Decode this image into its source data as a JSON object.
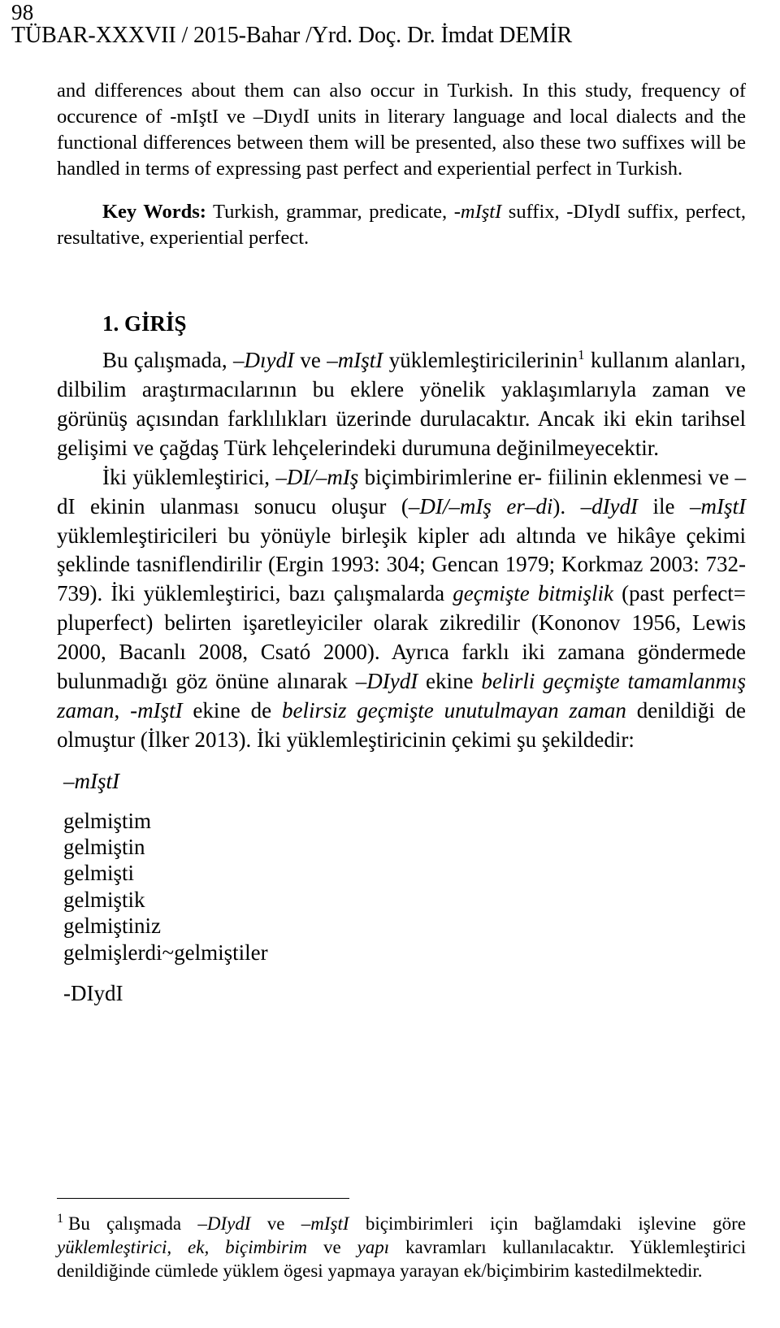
{
  "header": {
    "page_number": "98",
    "running_head": "TÜBAR-XXXVII / 2015-Bahar /Yrd. Doç. Dr. İmdat DEMİR"
  },
  "abstract": {
    "continuation": "and differences about them can also occur in Turkish. In this study, frequency of occurence of -mIştI ve –DıydI units in literary language and local dialects and the functional differences between them will be presented, also these two suffixes will be handled in terms of expressing past perfect and experiential perfect in Turkish.",
    "keywords_label": "Key Words:",
    "keywords_text": "Turkish, grammar, predicate, -mIştI suffix, -DIydI suffix, perfect, resultative, experiential perfect."
  },
  "section": {
    "number_title": "1. GİRİŞ",
    "paragraphs": [
      "Bu çalışmada, –DıydI ve –mIştI yüklemleştiricilerinin1 kullanım alanları, dilbilim araştırmacılarının bu eklere yönelik yaklaşımlarıyla zaman ve görünüş açısından farklılıkları üzerinde durulacaktır. Ancak iki ekin tarihsel gelişimi ve çağdaş Türk lehçelerindeki durumuna değinilmeyecektir.",
      "İki yüklemleştirici, –DI/–mIş biçimbirimlerine er- fiilinin eklenmesi ve –dI ekinin ulanması sonucu oluşur (–DI/–mIş er–di). –dIydI ile –mIştI yüklemleştiricileri bu yönüyle birleşik kipler adı altında ve hikâye çekimi şeklinde tasniflendirilir (Ergin 1993: 304; Gencan 1979; Korkmaz 2003: 732-739). İki yüklemleştirici, bazı çalışmalarda geçmişte bitmişlik (past perfect= pluperfect) belirten işaretleyiciler olarak zikredilir (Kononov 1956, Lewis 2000, Bacanlı 2008, Csató 2000). Ayrıca farklı iki zamana göndermede bulunmadığı göz önüne alınarak –DIydI ekine belirli geçmişte tamamlanmış zaman, -mIştI ekine de belirsiz geçmişte unutulmayan zaman denildiği de olmuştur (İlker 2013). İki yüklemleştiricinin çekimi şu şekildedir:"
    ]
  },
  "paradigm": {
    "heading": "–mIştI",
    "forms": [
      "gelmiştim",
      "gelmiştin",
      "gelmişti",
      "gelmiştik",
      "gelmiştiniz",
      "gelmişlerdi~gelmiştiler"
    ],
    "second_heading": "-DIydI"
  },
  "footnote": {
    "marker": "1",
    "text": "Bu çalışmada –DIydI ve –mIştI biçimbirimleri için bağlamdaki işlevine göre yüklemleştirici, ek, biçimbirim ve yapı kavramları kullanılacaktır. Yüklemleştirici denildiğinde cümlede yüklem ögesi yapmaya yarayan ek/biçimbirim kastedilmektedir."
  }
}
